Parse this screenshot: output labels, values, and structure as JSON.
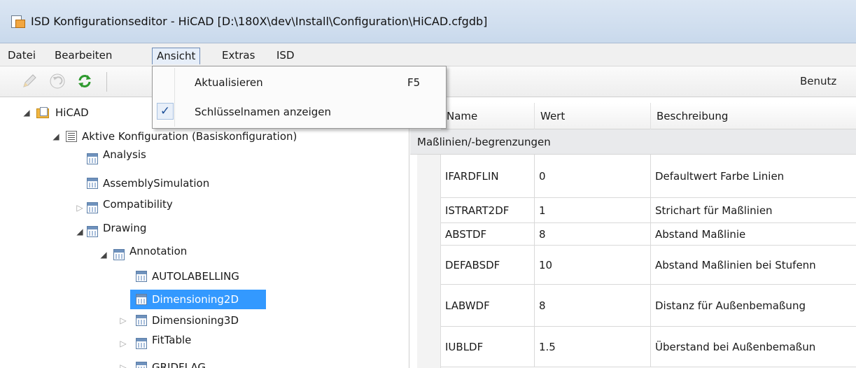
{
  "window": {
    "title": "ISD Konfigurationseditor  - HiCAD [D:\\180X\\dev\\Install\\Configuration\\HiCAD.cfgdb]"
  },
  "menu": {
    "items": [
      "Datei",
      "Bearbeiten",
      "Ansicht",
      "Extras",
      "ISD"
    ],
    "active_item": "Ansicht"
  },
  "toolbar": {
    "icons": [
      "pencil-icon",
      "undo-icon",
      "refresh-icon"
    ],
    "right_label": "Benutz"
  },
  "dropdown": {
    "items": [
      {
        "label": "Aktualisieren",
        "shortcut": "F5",
        "checked": false
      },
      {
        "label": "Schlüsselnamen anzeigen",
        "shortcut": "",
        "checked": true
      }
    ]
  },
  "tree": {
    "root": "HiCAD",
    "config": "Aktive Konfiguration (Basiskonfiguration)",
    "nodes": {
      "analysis": "Analysis",
      "assembly": "AssemblySimulation",
      "compat": "Compatibility",
      "drawing": "Drawing",
      "annotation": "Annotation",
      "autolabelling": "AUTOLABELLING",
      "dim2d": "Dimensioning2D",
      "dim3d": "Dimensioning3D",
      "fittable": "FitTable",
      "gridflag": "GRIDFLAG"
    },
    "selected": "Dimensioning2D"
  },
  "table": {
    "columns": [
      "Name",
      "Wert",
      "Beschreibung"
    ],
    "group": "Maßlinien/-begrenzungen",
    "rows": [
      {
        "name": "IFARDFLIN",
        "wert": "0",
        "beschreibung": "Defaultwert Farbe Linien"
      },
      {
        "name": "ISTRART2DF",
        "wert": "1",
        "beschreibung": "Strichart für Maßlinien"
      },
      {
        "name": "ABSTDF",
        "wert": "8",
        "beschreibung": "Abstand Maßlinie"
      },
      {
        "name": "DEFABSDF",
        "wert": "10",
        "beschreibung": "Abstand Maßlinien bei Stufenn"
      },
      {
        "name": "LABWDF",
        "wert": "8",
        "beschreibung": "Distanz für Außenbemaßung"
      },
      {
        "name": "IUBLDF",
        "wert": "1.5",
        "beschreibung": "Überstand bei Außenbemaßun"
      }
    ]
  },
  "colors": {
    "selection": "#3399ff",
    "menu_active_border": "#6e8bb5"
  }
}
